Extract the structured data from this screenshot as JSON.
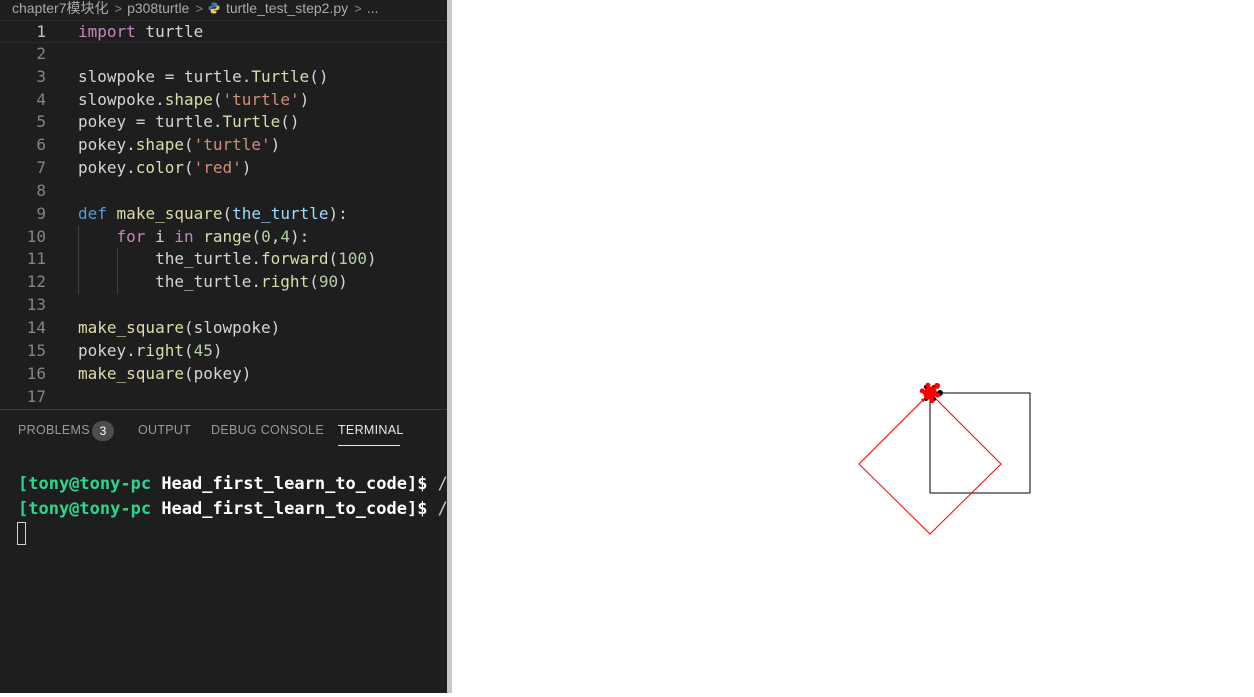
{
  "breadcrumb": {
    "folder": "chapter7模块化",
    "subfolder": "p308turtle",
    "file": "turtle_test_step2.py",
    "more": "..."
  },
  "code_lines": [
    {
      "n": "1",
      "t": "import turtle"
    },
    {
      "n": "2",
      "t": ""
    },
    {
      "n": "3",
      "t": "slowpoke = turtle.Turtle()"
    },
    {
      "n": "4",
      "t": "slowpoke.shape('turtle')"
    },
    {
      "n": "5",
      "t": "pokey = turtle.Turtle()"
    },
    {
      "n": "6",
      "t": "pokey.shape('turtle')"
    },
    {
      "n": "7",
      "t": "pokey.color('red')"
    },
    {
      "n": "8",
      "t": ""
    },
    {
      "n": "9",
      "t": "def make_square(the_turtle):"
    },
    {
      "n": "10",
      "t": "    for i in range(0,4):"
    },
    {
      "n": "11",
      "t": "        the_turtle.forward(100)"
    },
    {
      "n": "12",
      "t": "        the_turtle.right(90)"
    },
    {
      "n": "13",
      "t": ""
    },
    {
      "n": "14",
      "t": "make_square(slowpoke)"
    },
    {
      "n": "15",
      "t": "pokey.right(45)"
    },
    {
      "n": "16",
      "t": "make_square(pokey)"
    },
    {
      "n": "17",
      "t": ""
    }
  ],
  "panel": {
    "tabs": [
      "PROBLEMS",
      "OUTPUT",
      "DEBUG CONSOLE",
      "TERMINAL"
    ],
    "active_tab": "TERMINAL",
    "problems_count": "3"
  },
  "terminal": {
    "lines": [
      {
        "user": "[tony@tony-pc",
        "dir": "Head_first_learn_to_code",
        "prompt": "]$",
        "rest": " /u"
      },
      {
        "user": "[tony@tony-pc",
        "dir": "Head_first_learn_to_code",
        "prompt": "]$",
        "rest": " /u"
      }
    ]
  },
  "turtle_canvas": {
    "slowpoke_color": "#000000",
    "pokey_color": "#ff0000"
  }
}
